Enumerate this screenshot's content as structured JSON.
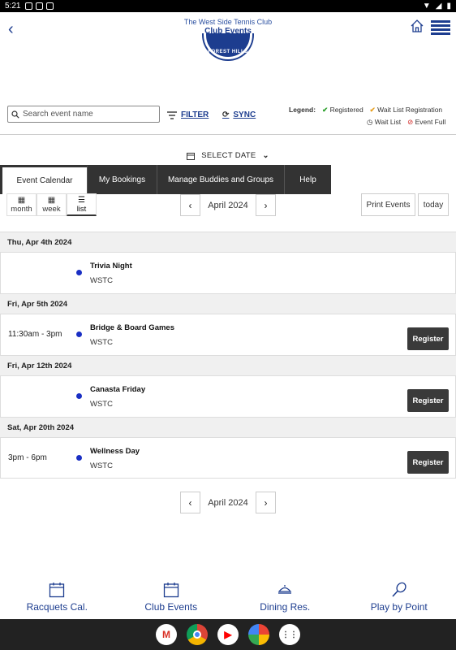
{
  "status_bar": {
    "time": "5:21"
  },
  "header": {
    "back_glyph": "‹",
    "club_name": "The West Side Tennis Club",
    "page_title": "Club Events",
    "logo_text": "FOREST HILLS"
  },
  "search": {
    "placeholder": "Search event name"
  },
  "toolbar": {
    "filter_label": "FILTER",
    "sync_label": "SYNC"
  },
  "legend": {
    "title": "Legend:",
    "registered": "Registered",
    "wait_list_registration": "Wait List Registration",
    "wait_list": "Wait List",
    "event_full": "Event Full"
  },
  "select_date": {
    "label": "SELECT DATE"
  },
  "tabs": [
    {
      "label": "Event Calendar",
      "active": true
    },
    {
      "label": "My Bookings"
    },
    {
      "label": "Manage Buddies and Groups"
    },
    {
      "label": "Help"
    }
  ],
  "views": [
    {
      "label": "month",
      "icon": "calendar-icon"
    },
    {
      "label": "week",
      "icon": "calendar-icon"
    },
    {
      "label": "list",
      "icon": "list-icon",
      "active": true
    }
  ],
  "calendar_nav": {
    "month": "April 2024",
    "prev": "‹",
    "next": "›"
  },
  "actions": {
    "print": "Print Events",
    "today": "today"
  },
  "days": [
    {
      "date": "Thu, Apr 4th 2024",
      "events": [
        {
          "time": "",
          "name": "Trivia Night",
          "location": "WSTC",
          "register": false
        }
      ]
    },
    {
      "date": "Fri, Apr 5th 2024",
      "events": [
        {
          "time": "11:30am - 3pm",
          "name": "Bridge & Board Games",
          "location": "WSTC",
          "register": true
        }
      ]
    },
    {
      "date": "Fri, Apr 12th 2024",
      "events": [
        {
          "time": "",
          "name": "Canasta Friday",
          "location": "WSTC",
          "register": true
        }
      ]
    },
    {
      "date": "Sat, Apr 20th 2024",
      "events": [
        {
          "time": "3pm - 6pm",
          "name": "Wellness Day",
          "location": "WSTC",
          "register": true
        }
      ]
    }
  ],
  "register_label": "Register",
  "bottom_nav": [
    {
      "label": "Racquets Cal.",
      "icon": "calendar-icon"
    },
    {
      "label": "Club Events",
      "icon": "calendar-icon"
    },
    {
      "label": "Dining Res.",
      "icon": "dining-icon"
    },
    {
      "label": "Play by Point",
      "icon": "racquet-icon"
    }
  ],
  "colors": {
    "brand": "#1d3d8f",
    "event_dot": "#1a2fc4",
    "tab_bar": "#333333"
  }
}
